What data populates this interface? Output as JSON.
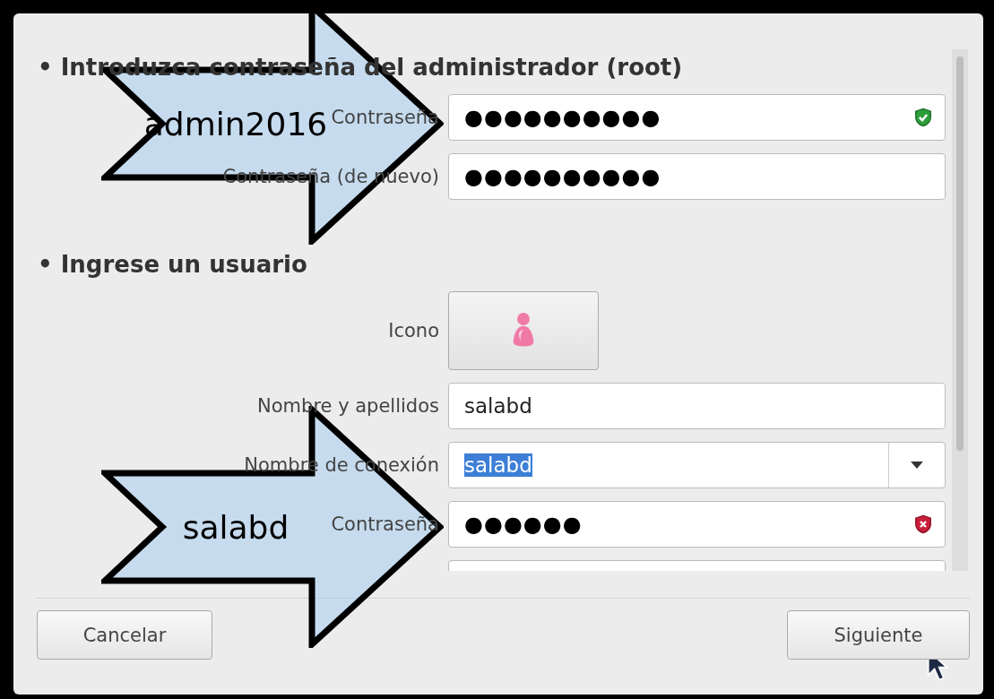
{
  "sections": [
    {
      "title": "• Introduzca contraseña del administrador (root)",
      "fields": [
        {
          "kind": "password",
          "label": "Contraseña",
          "value": "●●●●●●●●●●",
          "valid": true
        },
        {
          "kind": "password",
          "label": "Contraseña (de nuevo)",
          "value": "●●●●●●●●●●"
        }
      ]
    },
    {
      "title": "• Ingrese un usuario",
      "fields": [
        {
          "kind": "icon",
          "label": "Icono"
        },
        {
          "kind": "text",
          "label": "Nombre y apellidos",
          "value": "salabd"
        },
        {
          "kind": "combo",
          "label": "Nombre de conexión",
          "value": "salabd",
          "selected": true
        },
        {
          "kind": "password",
          "label": "Contraseña",
          "value": "●●●●●●",
          "valid": false
        },
        {
          "kind": "blank"
        }
      ]
    }
  ],
  "buttons": [
    {
      "label": "Cancelar"
    },
    {
      "label": "Siguiente"
    }
  ],
  "callouts": [
    {
      "text": "admin2016"
    },
    {
      "text": "salabd"
    }
  ]
}
